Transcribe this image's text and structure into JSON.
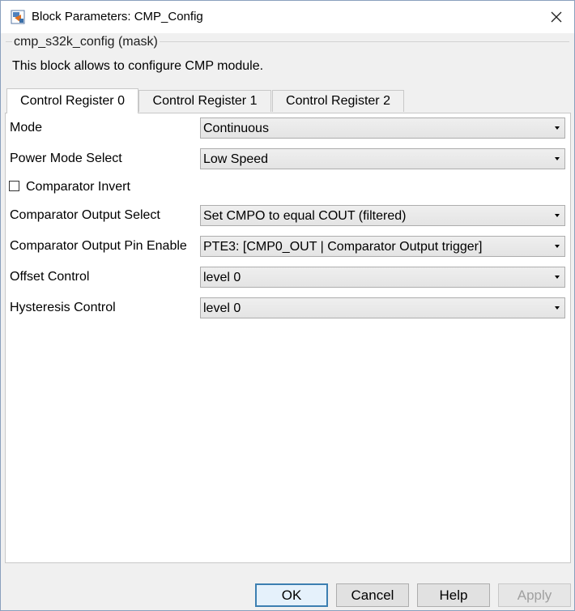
{
  "window": {
    "title": "Block Parameters: CMP_Config",
    "icons": {
      "app": "simulink-block-icon",
      "close": "close-icon"
    }
  },
  "mask": {
    "group_title": "cmp_s32k_config (mask)",
    "description": "This block allows to configure CMP module."
  },
  "tabs": [
    {
      "label": "Control Register 0",
      "active": true
    },
    {
      "label": "Control Register 1",
      "active": false
    },
    {
      "label": "Control Register 2",
      "active": false
    }
  ],
  "params": {
    "mode": {
      "label": "Mode",
      "value": "Continuous"
    },
    "power_mode": {
      "label": "Power Mode Select",
      "value": "Low Speed"
    },
    "comparator_invert": {
      "label": "Comparator Invert",
      "checked": false
    },
    "output_select": {
      "label": "Comparator Output Select",
      "value": "Set CMPO to equal COUT (filtered)"
    },
    "pin_enable": {
      "label": "Comparator Output Pin Enable",
      "value": "PTE3: [CMP0_OUT | Comparator Output trigger]"
    },
    "offset": {
      "label": "Offset Control",
      "value": "level 0"
    },
    "hysteresis": {
      "label": "Hysteresis Control",
      "value": "level 0"
    }
  },
  "buttons": {
    "ok": "OK",
    "cancel": "Cancel",
    "help": "Help",
    "apply": {
      "label": "Apply",
      "enabled": false
    }
  },
  "colors": {
    "accent": "#3c7fb1",
    "panel_bg": "#ffffff",
    "dialog_bg": "#f0f0f0"
  }
}
